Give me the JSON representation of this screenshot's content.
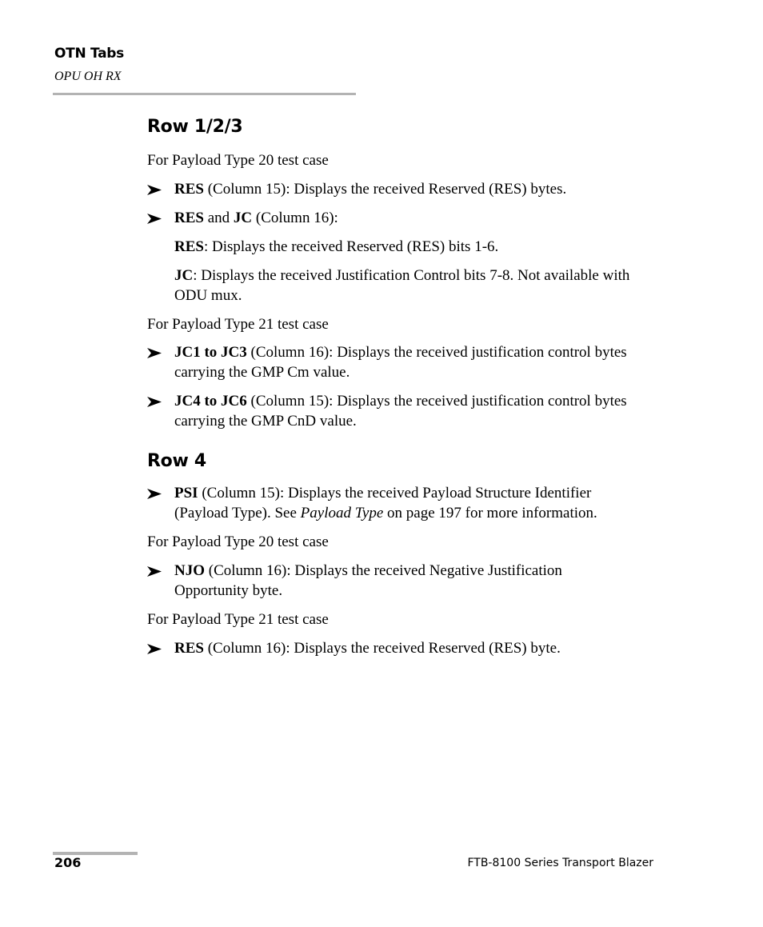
{
  "header": {
    "chapter": "OTN Tabs",
    "section": "OPU OH RX"
  },
  "sections": [
    {
      "heading": "Row 1/2/3",
      "blocks": {
        "pt20_label": "For Payload Type 20 test case",
        "b1": {
          "bold": "RES",
          "text": " (Column 15): Displays the received Reserved (RES) bytes."
        },
        "b2": {
          "bold1": "RES",
          "mid": " and ",
          "bold2": "JC",
          "text": " (Column 16):"
        },
        "sub1": {
          "bold": "RES",
          "text": ": Displays the received Reserved (RES) bits 1-6."
        },
        "sub2": {
          "bold": "JC",
          "text": ": Displays the received Justification Control bits 7-8. Not available with ODU mux."
        },
        "pt21_label": "For Payload Type 21 test case",
        "b3": {
          "bold": "JC1 to JC3",
          "text": " (Column 16): Displays the received justification control bytes carrying the GMP Cm value."
        },
        "b4": {
          "bold": "JC4 to JC6",
          "text": " (Column 15): Displays the received justification control bytes carrying the GMP CnD value."
        }
      }
    },
    {
      "heading": "Row 4",
      "blocks": {
        "b1": {
          "bold": "PSI",
          "text": " (Column 15): Displays the received Payload Structure Identifier (Payload Type). See ",
          "link": "Payload Type",
          "tail": " on page 197 for more information."
        },
        "pt20_label": "For Payload Type 20 test case",
        "b2": {
          "bold": "NJO",
          "text": " (Column 16): Displays the received Negative Justification Opportunity byte."
        },
        "pt21_label": "For Payload Type 21 test case",
        "b3": {
          "bold": "RES",
          "text": " (Column 16): Displays the received Reserved (RES) byte."
        }
      }
    }
  ],
  "footer": {
    "page_number": "206",
    "product": "FTB-8100 Series Transport Blazer"
  },
  "icons": {
    "bullet": "arrowhead-right-icon"
  },
  "colors": {
    "rule": "#b3b3b3",
    "text": "#000000"
  }
}
